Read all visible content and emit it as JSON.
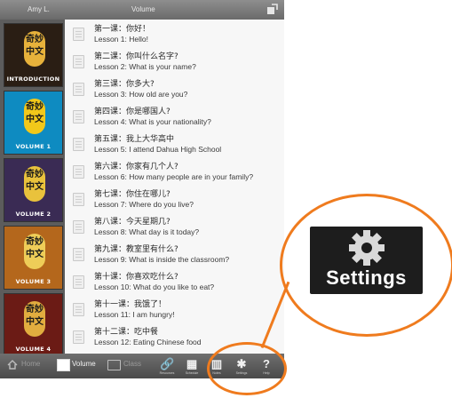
{
  "topbar": {
    "user": "Amy L.",
    "title": "Volume",
    "corner_icon": "export-icon"
  },
  "sidebar": {
    "volumes": [
      {
        "caption": "INTRODUCTION",
        "bg": "#2a1e14",
        "logo_bg": "#e7b23b",
        "chars": [
          "奇",
          "妙",
          "中",
          "文"
        ]
      },
      {
        "caption": "VOLUME 1",
        "bg": "#0e8bc1",
        "logo_bg": "#f2c81a",
        "chars": [
          "奇",
          "妙",
          "中",
          "文"
        ]
      },
      {
        "caption": "VOLUME 2",
        "bg": "#3a2b54",
        "logo_bg": "#e9c23c",
        "chars": [
          "奇",
          "妙",
          "中",
          "文"
        ]
      },
      {
        "caption": "VOLUME 3",
        "bg": "#b4671c",
        "logo_bg": "#eecd58",
        "chars": [
          "奇",
          "妙",
          "中",
          "文"
        ]
      },
      {
        "caption": "VOLUME 4",
        "bg": "#6b1b15",
        "logo_bg": "#e1ad3f",
        "chars": [
          "奇",
          "妙",
          "中",
          "文"
        ]
      }
    ]
  },
  "lessons": [
    {
      "zh": "第一课：你好！",
      "en": "Lesson 1:  Hello!"
    },
    {
      "zh": "第二课：你叫什么名字?",
      "en": "Lesson 2:  What is your name?"
    },
    {
      "zh": "第三课：你多大?",
      "en": "Lesson 3:  How old are you?"
    },
    {
      "zh": "第四课：你是哪国人?",
      "en": "Lesson 4:  What is your nationality?"
    },
    {
      "zh": "第五课：我上大华高中",
      "en": "Lesson 5:  I attend Dahua High School"
    },
    {
      "zh": "第六课：你家有几个人?",
      "en": "Lesson 6:  How many people are in your family?"
    },
    {
      "zh": "第七课：你住在哪儿?",
      "en": "Lesson 7:  Where do you live?"
    },
    {
      "zh": "第八课：今天星期几?",
      "en": "Lesson 8:  What day is it today?"
    },
    {
      "zh": "第九课：教室里有什么?",
      "en": "Lesson 9:  What is inside the classroom?"
    },
    {
      "zh": "第十课：你喜欢吃什么?",
      "en": "Lesson 10:  What do you like to eat?"
    },
    {
      "zh": "第十一课：我饿了！",
      "en": "Lesson 11:  I am hungry!"
    },
    {
      "zh": "第十二课：吃中餐",
      "en": "Lesson 12:  Eating Chinese food"
    }
  ],
  "tabbar": {
    "home": "Home",
    "volume": "Volume",
    "class": "Class",
    "tools": [
      {
        "icon": "link-icon",
        "glyph": "🔗",
        "sub": "Resources"
      },
      {
        "icon": "calendar-icon",
        "glyph": "▦",
        "sub": "Schedule"
      },
      {
        "icon": "notebook-icon",
        "glyph": "▥",
        "sub": "Notes"
      },
      {
        "icon": "settings-gear-icon",
        "glyph": "✱",
        "sub": "Settings"
      },
      {
        "icon": "help-icon",
        "glyph": "?",
        "sub": "Help"
      }
    ]
  },
  "callout": {
    "label": "Settings"
  },
  "colors": {
    "accent": "#ef7b1e",
    "tabbar": "#5a5a5a"
  }
}
